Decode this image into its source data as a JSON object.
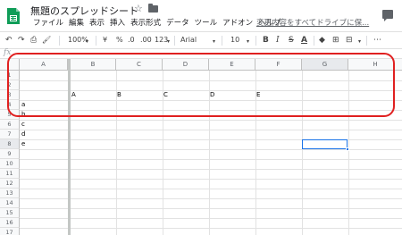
{
  "header": {
    "title": "無題のスプレッドシート",
    "star_icon": "☆",
    "save_note": "変更内容をすべてドライブに保...",
    "menu": [
      "ファイル",
      "編集",
      "表示",
      "挿入",
      "表示形式",
      "データ",
      "ツール",
      "アドオン",
      "ヘルプ"
    ]
  },
  "toolbar": {
    "undo": "↶",
    "redo": "↷",
    "print": "⎙",
    "paint_format": "🖌",
    "zoom": "100%",
    "currency": "¥",
    "percent": "%",
    "decrease_decimal": ".0",
    "increase_decimal": ".00",
    "number_format": "123",
    "font": "Arial",
    "font_size": "10",
    "bold": "B",
    "italic": "I",
    "strikethrough": "S",
    "text_color": "A",
    "more": "⋯"
  },
  "formula_bar": {
    "fx": "fx",
    "value": ""
  },
  "grid": {
    "columns": [
      "A",
      "B",
      "C",
      "D",
      "E",
      "F",
      "G",
      "H"
    ],
    "rows": [
      "1",
      "2",
      "3",
      "4",
      "5",
      "6",
      "7",
      "8",
      "9",
      "10",
      "11",
      "12",
      "13",
      "14",
      "15",
      "16",
      "17"
    ],
    "cells": {
      "row3": [
        "A",
        "B",
        "C",
        "D",
        "E"
      ],
      "colA": [
        "a",
        "b",
        "c",
        "d",
        "e"
      ]
    },
    "selected_column": "G",
    "selected_row": "8"
  },
  "colors": {
    "annotation": "#e02020",
    "selection": "#1a73e8"
  }
}
